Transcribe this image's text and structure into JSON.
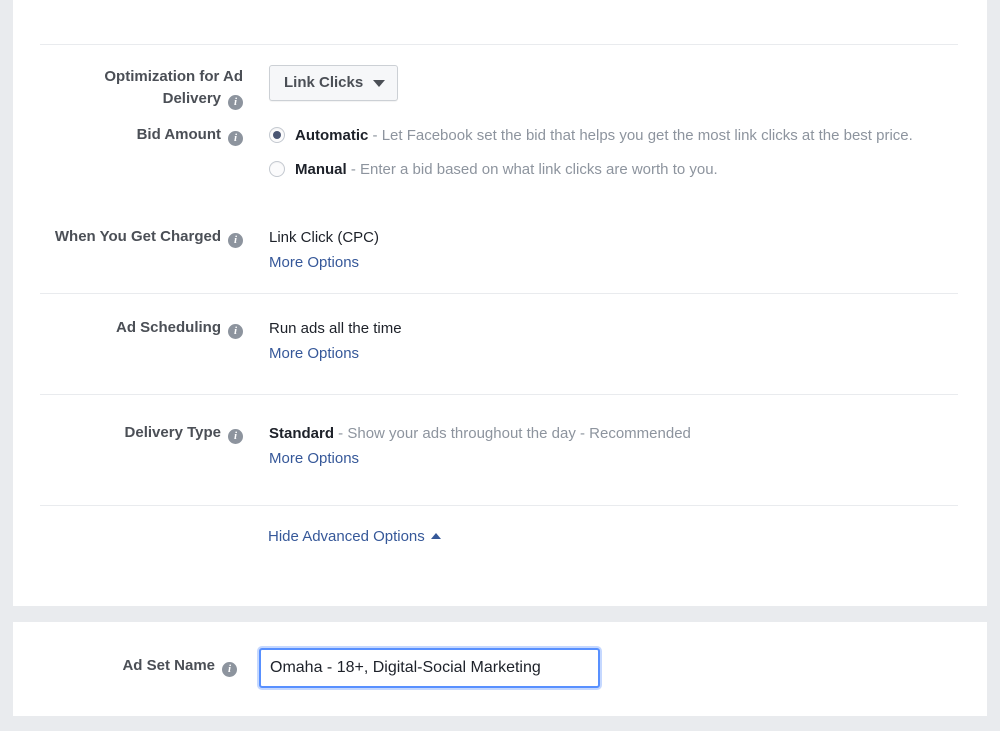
{
  "colors": {
    "page_background": "#e9ebee",
    "card_background": "#ffffff",
    "label": "#4b4f56",
    "muted_text": "#8d949e",
    "link": "#365899",
    "focus_border": "#5890ff",
    "radio_dot": "#4a5673",
    "divider": "#e9ebee"
  },
  "icons": {
    "info": "info-icon",
    "caret_down": "chevron-down-icon",
    "caret_up": "chevron-up-icon"
  },
  "advanced_card": {
    "optimization": {
      "label": "Optimization for Ad Delivery",
      "label_line1": "Optimization for Ad",
      "label_line2": "Delivery",
      "info": "i",
      "select_value": "Link Clicks",
      "options": [
        "Link Clicks"
      ]
    },
    "bid_amount": {
      "label": "Bid Amount",
      "info": "i",
      "options": [
        {
          "id": "automatic",
          "title": "Automatic",
          "separator": " - ",
          "description": "Let Facebook set the bid that helps you get the most link clicks at the best price.",
          "selected": true
        },
        {
          "id": "manual",
          "title": "Manual",
          "separator": " - ",
          "description": "Enter a bid based on what link clicks are worth to you.",
          "selected": false
        }
      ]
    },
    "when_charged": {
      "label": "When You Get Charged",
      "info": "i",
      "value": "Link Click (CPC)",
      "more_options": "More Options"
    },
    "ad_scheduling": {
      "label": "Ad Scheduling",
      "info": "i",
      "value": "Run ads all the time",
      "more_options": "More Options"
    },
    "delivery_type": {
      "label": "Delivery Type",
      "info": "i",
      "value_bold": "Standard",
      "value_rest": " - Show your ads throughout the day - Recommended",
      "more_options": "More Options"
    },
    "hide_advanced": {
      "label": "Hide Advanced Options"
    }
  },
  "adset_name_card": {
    "label": "Ad Set Name",
    "info": "i",
    "value": "Omaha - 18+, Digital-Social Marketing",
    "placeholder": "Ad Set Name"
  }
}
